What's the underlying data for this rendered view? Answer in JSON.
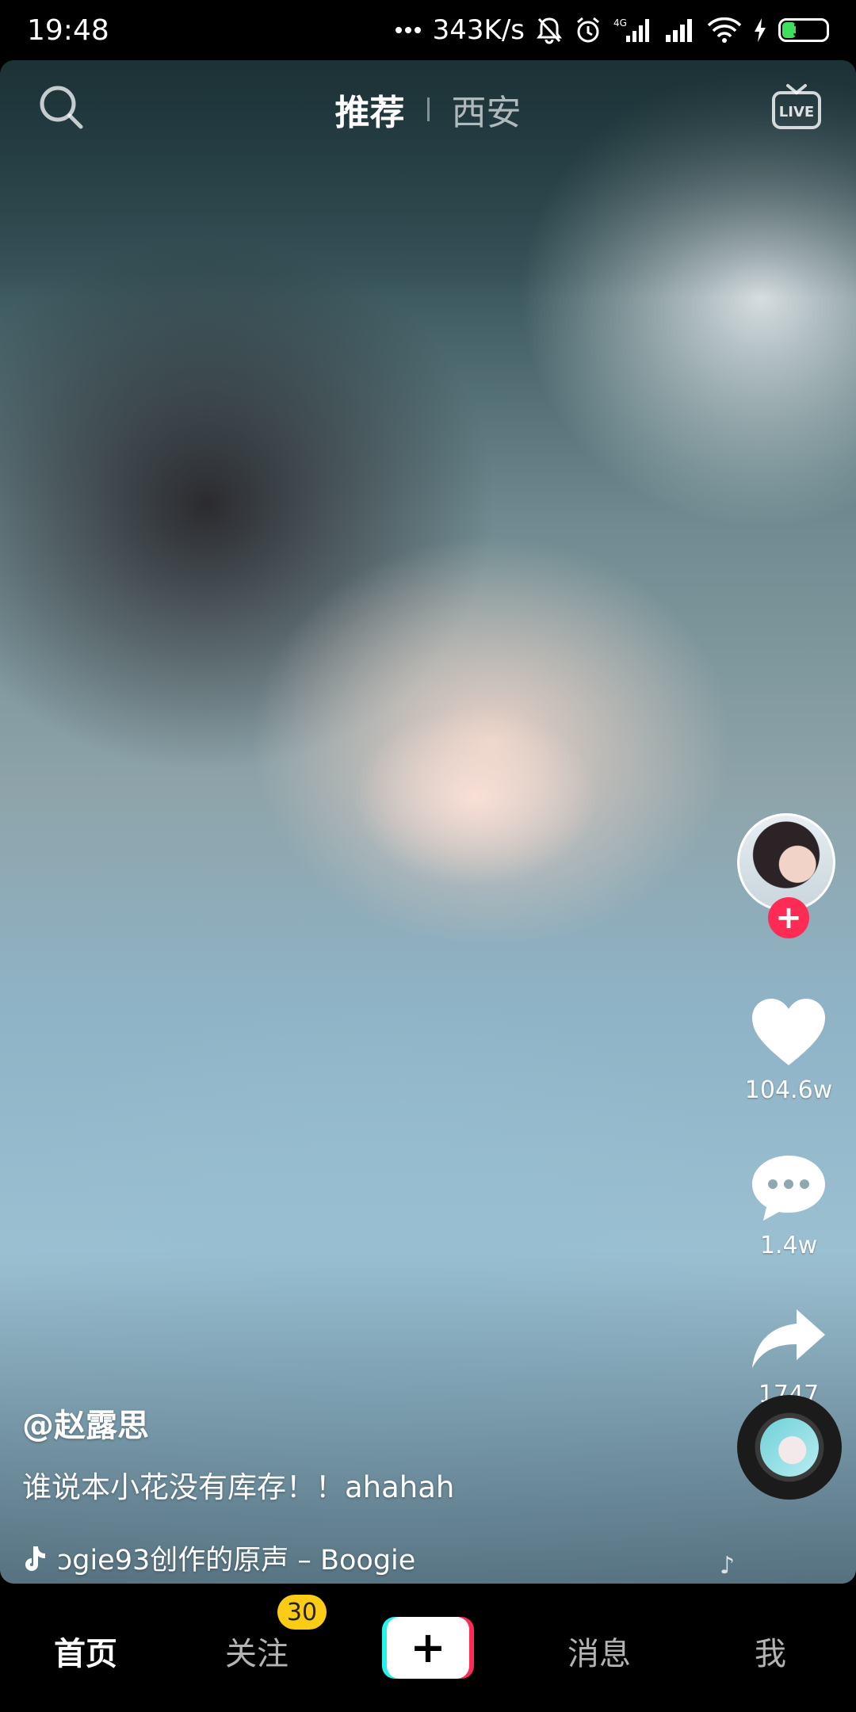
{
  "status_bar": {
    "time": "19:48",
    "network_speed": "343K/s",
    "network_type": "4G",
    "battery_level": "30",
    "icons": [
      "dots-icon",
      "mute-bell-icon",
      "alarm-icon",
      "signal-4g-icon",
      "signal-icon",
      "wifi-icon",
      "charging-icon",
      "battery-icon"
    ]
  },
  "top_nav": {
    "tabs": [
      {
        "label": "推荐",
        "active": true
      },
      {
        "label": "西安",
        "active": false
      }
    ],
    "search_icon": "search-icon",
    "live_label": "LIVE"
  },
  "rail": {
    "like_count": "104.6w",
    "comment_count": "1.4w",
    "share_count": "1747",
    "follow_symbol": "+"
  },
  "caption": {
    "author": "@赵露思",
    "description": "谁说本小花没有库存！！ahahah",
    "music": "ɔgie93创作的原声 – Boogie"
  },
  "bottom_nav": {
    "home": "首页",
    "follow": "关注",
    "follow_badge": "30",
    "create_symbol": "+",
    "messages": "消息",
    "me": "我"
  },
  "colors": {
    "accent_red": "#fe2c55",
    "accent_cyan": "#25f4ee",
    "badge_yellow": "#facc15",
    "battery_green": "#3ee05b"
  }
}
